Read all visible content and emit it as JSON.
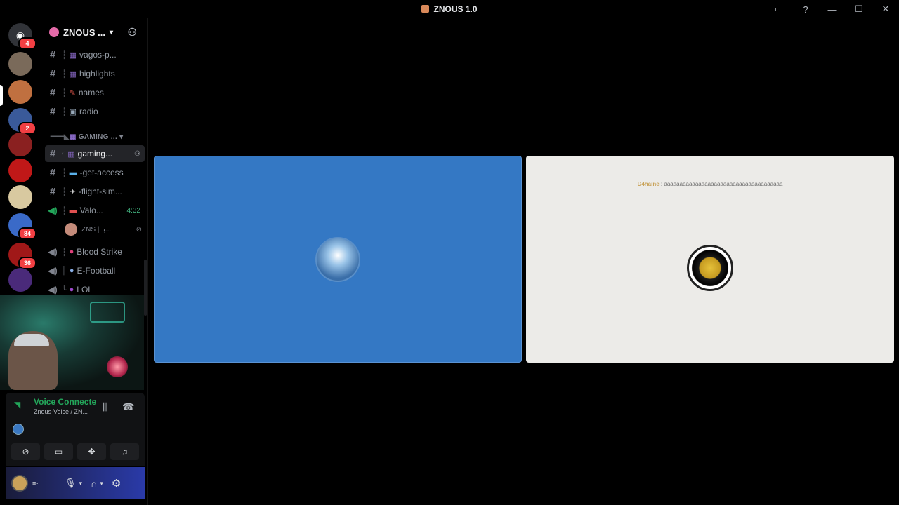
{
  "window": {
    "title": "ZNOUS 1.0"
  },
  "guild_badges": [
    "4",
    "2",
    "84",
    "36"
  ],
  "server": {
    "name": "ZNOUS ..."
  },
  "channels": [
    {
      "label": "vagos-p..."
    },
    {
      "label": "highlights"
    },
    {
      "label": "names"
    },
    {
      "label": "radio"
    }
  ],
  "category": {
    "label": "GAMING ..."
  },
  "gaming_channels": [
    {
      "label": "gaming..."
    },
    {
      "label": "-get-access"
    },
    {
      "label": "-flight-sim..."
    },
    {
      "label": "Valo...",
      "time": "4:32"
    }
  ],
  "voice_member": {
    "label": "ZNS | بـ..."
  },
  "voice_channels": [
    {
      "label": "Blood Strike"
    },
    {
      "label": "E-Football"
    },
    {
      "label": "LOL"
    }
  ],
  "voice_panel": {
    "status": "Voice Connecte",
    "location": "Znous-Voice / ZN..."
  },
  "tiles": {
    "caption_name": "D4haine",
    "caption_text": ": aaaaaaaaaaaaaaaaaaaaaaaaaaaaaaaaaaaaaa"
  }
}
